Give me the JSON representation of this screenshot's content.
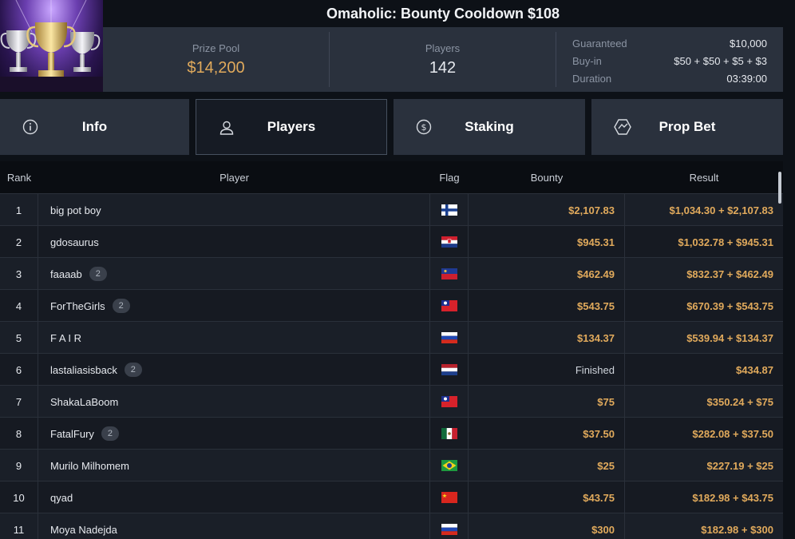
{
  "tournament": {
    "title": "Omaholic: Bounty Cooldown $108",
    "prize_pool_label": "Prize Pool",
    "prize_pool_value": "$14,200",
    "players_label": "Players",
    "players_value": "142",
    "meta": [
      {
        "key": "Guaranteed",
        "value": "$10,000"
      },
      {
        "key": "Buy-in",
        "value": "$50 + $50 + $5 + $3"
      },
      {
        "key": "Duration",
        "value": "03:39:00"
      }
    ]
  },
  "tabs": [
    {
      "label": "Info",
      "icon": "info-icon",
      "active": false
    },
    {
      "label": "Players",
      "icon": "user-icon",
      "active": true
    },
    {
      "label": "Staking",
      "icon": "dollar-circle-icon",
      "active": false
    },
    {
      "label": "Prop Bet",
      "icon": "prop-bet-icon",
      "active": false
    }
  ],
  "table": {
    "headers": {
      "rank": "Rank",
      "player": "Player",
      "flag": "Flag",
      "bounty": "Bounty",
      "result": "Result"
    },
    "rows": [
      {
        "rank": "1",
        "player": "big pot boy",
        "badge": "",
        "flag": "finland",
        "bounty": "$2,107.83",
        "result": "$1,034.30 + $2,107.83"
      },
      {
        "rank": "2",
        "player": "gdosaurus",
        "badge": "",
        "flag": "croatia",
        "bounty": "$945.31",
        "result": "$1,032.78 + $945.31"
      },
      {
        "rank": "3",
        "player": "faaaab",
        "badge": "2",
        "flag": "liechtenstein",
        "bounty": "$462.49",
        "result": "$832.37 + $462.49"
      },
      {
        "rank": "4",
        "player": "ForTheGirls",
        "badge": "2",
        "flag": "taiwan",
        "bounty": "$543.75",
        "result": "$670.39 + $543.75"
      },
      {
        "rank": "5",
        "player": "F A I R",
        "badge": "",
        "flag": "russia",
        "bounty": "$134.37",
        "result": "$539.94 + $134.37"
      },
      {
        "rank": "6",
        "player": "lastaliasisback",
        "badge": "2",
        "flag": "netherlands",
        "bounty": "Finished",
        "result": "$434.87"
      },
      {
        "rank": "7",
        "player": "ShakaLaBoom",
        "badge": "",
        "flag": "taiwan",
        "bounty": "$75",
        "result": "$350.24 + $75"
      },
      {
        "rank": "8",
        "player": "FatalFury",
        "badge": "2",
        "flag": "mexico",
        "bounty": "$37.50",
        "result": "$282.08 + $37.50"
      },
      {
        "rank": "9",
        "player": "Murilo Milhomem",
        "badge": "",
        "flag": "brazil",
        "bounty": "$25",
        "result": "$227.19 + $25"
      },
      {
        "rank": "10",
        "player": "qyad",
        "badge": "",
        "flag": "china",
        "bounty": "$43.75",
        "result": "$182.98 + $43.75"
      },
      {
        "rank": "11",
        "player": "Moya Nadejda",
        "badge": "",
        "flag": "russia",
        "bounty": "$300",
        "result": "$182.98 + $300"
      }
    ]
  },
  "colors": {
    "accent_gold": "#e1aa5c",
    "panel": "#2a313d",
    "background": "#0d1117"
  }
}
